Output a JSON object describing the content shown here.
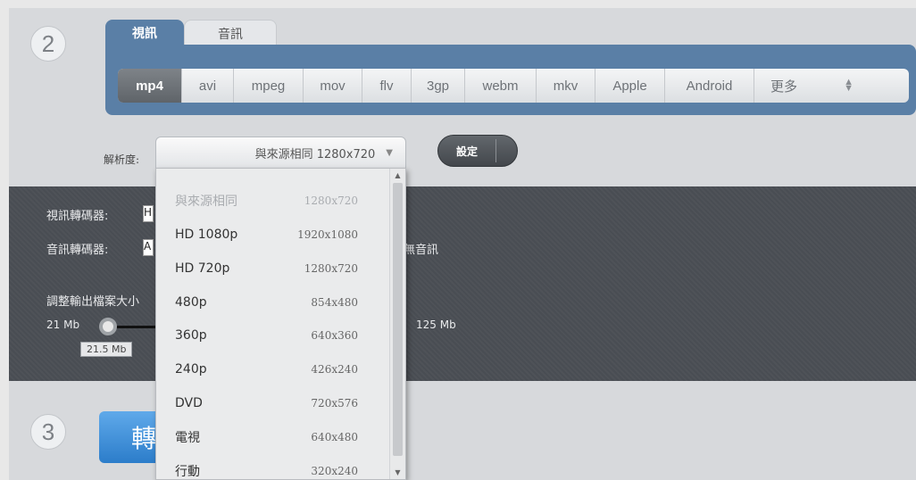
{
  "steps": {
    "two": "2",
    "three": "3"
  },
  "tabs": {
    "video": "視訊",
    "audio": "音訊"
  },
  "formats": [
    "mp4",
    "avi",
    "mpeg",
    "mov",
    "flv",
    "3gp",
    "webm",
    "mkv",
    "Apple",
    "Android"
  ],
  "formats_more": "更多",
  "resolution": {
    "label": "解析度:",
    "selected": "與來源相同 1280x720",
    "options": [
      {
        "name": "與來源相同",
        "res": "1280x720",
        "disabled": true
      },
      {
        "name": "HD 1080p",
        "res": "1920x1080"
      },
      {
        "name": "HD 720p",
        "res": "1280x720"
      },
      {
        "name": "480p",
        "res": "854x480"
      },
      {
        "name": "360p",
        "res": "640x360"
      },
      {
        "name": "240p",
        "res": "426x240"
      },
      {
        "name": "DVD",
        "res": "720x576"
      },
      {
        "name": "電視",
        "res": "640x480"
      },
      {
        "name": "行動",
        "res": "320x240"
      }
    ]
  },
  "settings_button": "設定",
  "advanced": {
    "video_codec_label": "視訊轉碼器:",
    "video_codec_value": "H",
    "audio_codec_label": "音訊轉碼器:",
    "audio_codec_value": "A",
    "no_audio_label": "無音訊",
    "size_label": "調整輸出檔案大小",
    "size_min": "21 Mb",
    "size_max": "125 Mb",
    "size_current": "21.5 Mb",
    "size_fraction": 0.005
  },
  "convert_button": "轉",
  "colors": {
    "accent": "#5a7fa6",
    "dark_panel": "#494d53",
    "convert": "#2c7dca"
  }
}
